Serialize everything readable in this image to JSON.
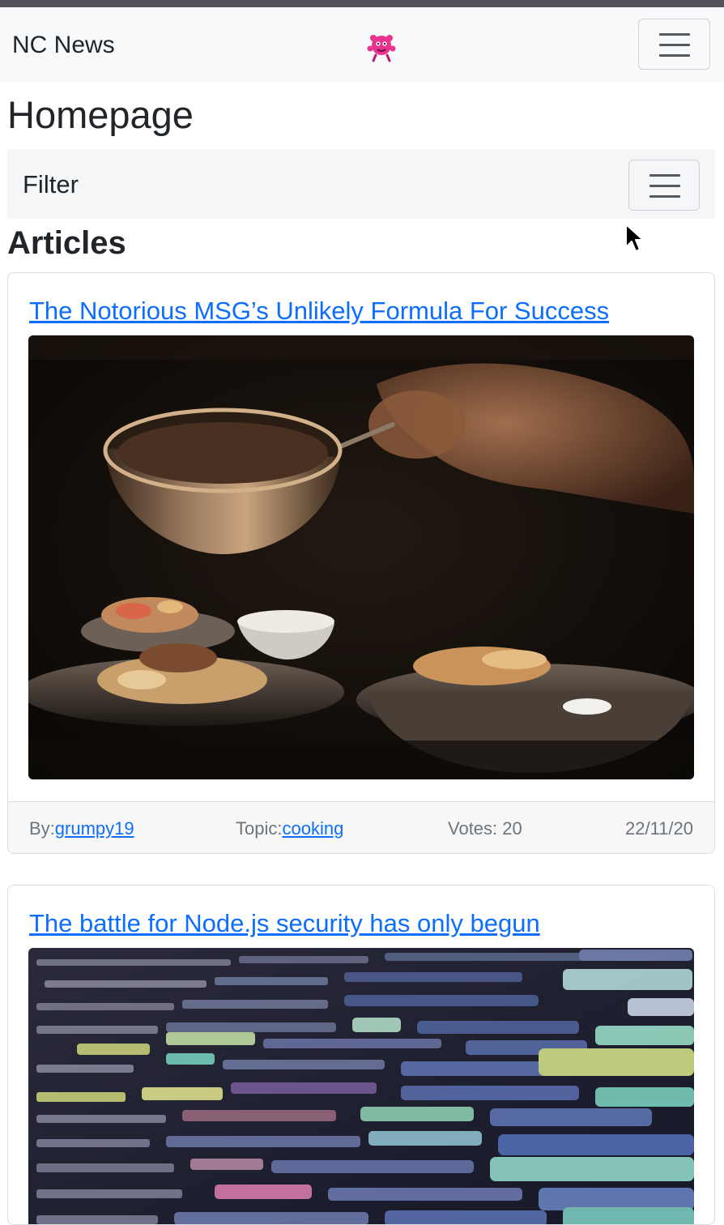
{
  "navbar": {
    "brand": "NC News",
    "logo_icon": "pink-mascot-icon",
    "menu_icon": "hamburger-icon"
  },
  "page": {
    "title": "Homepage"
  },
  "filter": {
    "label": "Filter",
    "menu_icon": "hamburger-icon"
  },
  "articles": {
    "heading": "Articles",
    "items": [
      {
        "title": "The Notorious MSG’s Unlikely Formula For Success",
        "image_desc": "photo",
        "author_label": "By:",
        "author": "grumpy19",
        "topic_label": "Topic:",
        "topic": "cooking",
        "votes": "Votes: 20",
        "date": "22/11/20"
      },
      {
        "title": "The battle for Node.js security has only begun",
        "image_desc": "photo"
      }
    ]
  },
  "colors": {
    "link": "#0d6efd",
    "navbar_bg": "#f8f9fa",
    "muted": "#6c757d"
  }
}
